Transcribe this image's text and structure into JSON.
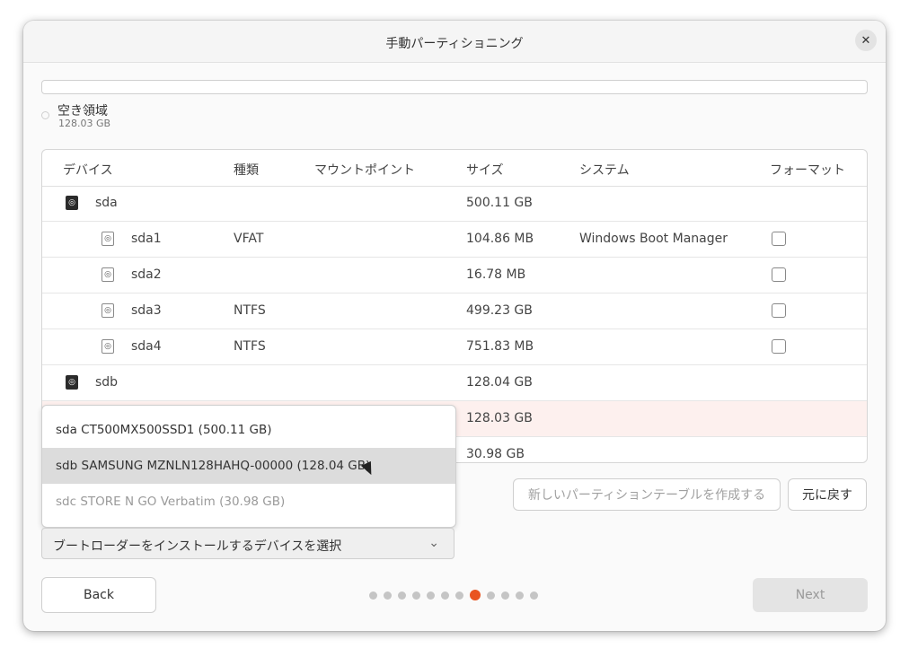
{
  "window": {
    "title": "手動パーティショニング"
  },
  "free_space": {
    "label": "空き領域",
    "size": "128.03 GB"
  },
  "table": {
    "headers": {
      "device": "デバイス",
      "type": "種類",
      "mount": "マウントポイント",
      "size": "サイズ",
      "system": "システム",
      "format": "フォーマット"
    },
    "rows": [
      {
        "device": "sda",
        "type": "",
        "mount": "",
        "size": "500.11 GB",
        "system": "",
        "kind": "disk"
      },
      {
        "device": "sda1",
        "type": "VFAT",
        "mount": "",
        "size": "104.86 MB",
        "system": "Windows Boot Manager",
        "kind": "partition"
      },
      {
        "device": "sda2",
        "type": "",
        "mount": "",
        "size": "16.78 MB",
        "system": "",
        "kind": "partition"
      },
      {
        "device": "sda3",
        "type": "NTFS",
        "mount": "",
        "size": "499.23 GB",
        "system": "",
        "kind": "partition"
      },
      {
        "device": "sda4",
        "type": "NTFS",
        "mount": "",
        "size": "751.83 MB",
        "system": "",
        "kind": "partition"
      },
      {
        "device": "sdb",
        "type": "",
        "mount": "",
        "size": "128.04 GB",
        "system": "",
        "kind": "disk"
      },
      {
        "device": "",
        "type": "",
        "mount": "",
        "size": "128.03 GB",
        "system": "",
        "kind": "free",
        "selected": true
      },
      {
        "device": "",
        "type": "",
        "mount": "",
        "size": "30.98 GB",
        "system": "",
        "kind": "disk"
      }
    ]
  },
  "buttons": {
    "new_table": "新しいパーティションテーブルを作成する",
    "revert": "元に戻す",
    "back": "Back",
    "next": "Next"
  },
  "bootloader": {
    "placeholder": "ブートローダーをインストールするデバイスを選択"
  },
  "dropdown_options": [
    {
      "label": "sda CT500MX500SSD1 (500.11 GB)",
      "state": "normal"
    },
    {
      "label": "sdb SAMSUNG MZNLN128HAHQ-00000 (128.04 GB)",
      "state": "hover"
    },
    {
      "label": "sdc STORE N GO Verbatim (30.98 GB)",
      "state": "disabled"
    }
  ],
  "pager": {
    "total": 12,
    "current": 8
  },
  "colors": {
    "accent": "#e95420",
    "selected_row": "#fdf0ee"
  }
}
